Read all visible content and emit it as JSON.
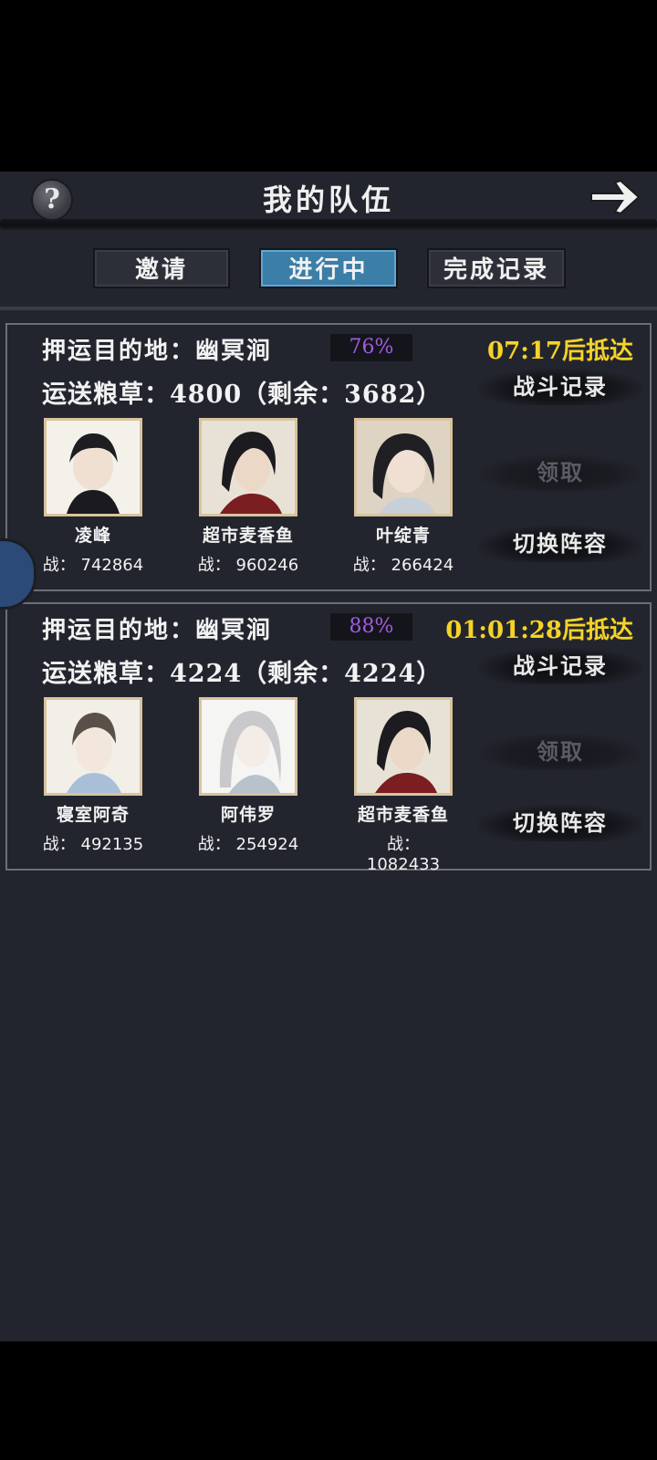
{
  "header": {
    "title": "我的队伍",
    "help_glyph": "?",
    "back_icon": "arrow-right-icon"
  },
  "tabs": [
    {
      "label": "邀请",
      "active": false
    },
    {
      "label": "进行中",
      "active": true
    },
    {
      "label": "完成记录",
      "active": false
    }
  ],
  "cards": [
    {
      "dest_label": "押运目的地：幽冥涧",
      "progress": "76%",
      "eta": "07:17后抵达",
      "cargo": "运送粮草：4800（剩余：3682）",
      "btn_battle": "战斗记录",
      "btn_claim": "领取",
      "btn_switch": "切换阵容",
      "heroes": [
        {
          "name": "凌峰",
          "power": "战：  742864"
        },
        {
          "name": "超市麦香鱼",
          "power": "战：  960246"
        },
        {
          "name": "叶绽青",
          "power": "战：  266424"
        }
      ]
    },
    {
      "dest_label": "押运目的地：幽冥涧",
      "progress": "88%",
      "eta": "01:01:28后抵达",
      "cargo": "运送粮草：4224（剩余：4224）",
      "btn_battle": "战斗记录",
      "btn_claim": "领取",
      "btn_switch": "切换阵容",
      "heroes": [
        {
          "name": "寝室阿奇",
          "power": "战：  492135"
        },
        {
          "name": "阿伟罗",
          "power": "战：  254924"
        },
        {
          "name": "超市麦香鱼",
          "power": "战：  1082433"
        }
      ]
    }
  ],
  "colors": {
    "background": "#23252e",
    "active_tab": "#3b7ea8",
    "eta": "#f5d327",
    "percent": "#a25be0"
  }
}
